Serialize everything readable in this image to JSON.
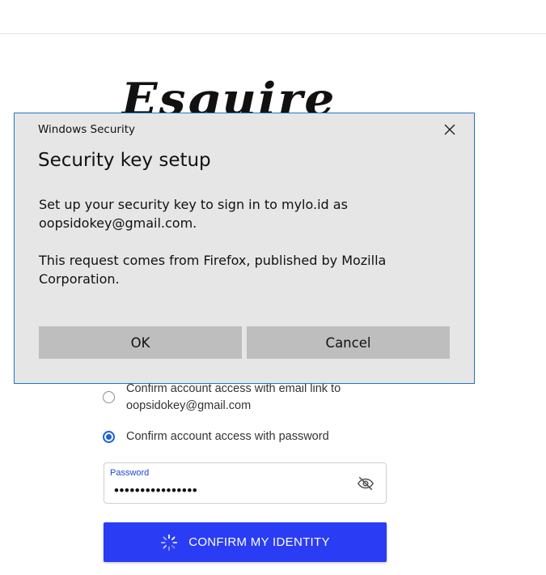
{
  "logo": {
    "text": "Esquire"
  },
  "options": {
    "email_link_line1": "Confirm account access with email link to",
    "email_link_line2": "oopsidokey@gmail.com",
    "password": "Confirm account access with password"
  },
  "password_field": {
    "label": "Password",
    "value": "••••••••••••••••"
  },
  "confirm_button": {
    "label": "CONFIRM MY IDENTITY"
  },
  "dialog": {
    "caption": "Windows Security",
    "heading": "Security key setup",
    "message1_line1": "Set up your security key to sign in to mylo.id as",
    "message1_line2": "oopsidokey@gmail.com.",
    "message2_line1": "This request comes from Firefox, published by Mozilla",
    "message2_line2": "Corporation.",
    "ok_label": "OK",
    "cancel_label": "Cancel"
  },
  "colors": {
    "primary_button": "#2a3df5",
    "radio_selected": "#1a63d8",
    "dialog_bg": "#e6e6e6",
    "dialog_border": "#1a78c8"
  }
}
